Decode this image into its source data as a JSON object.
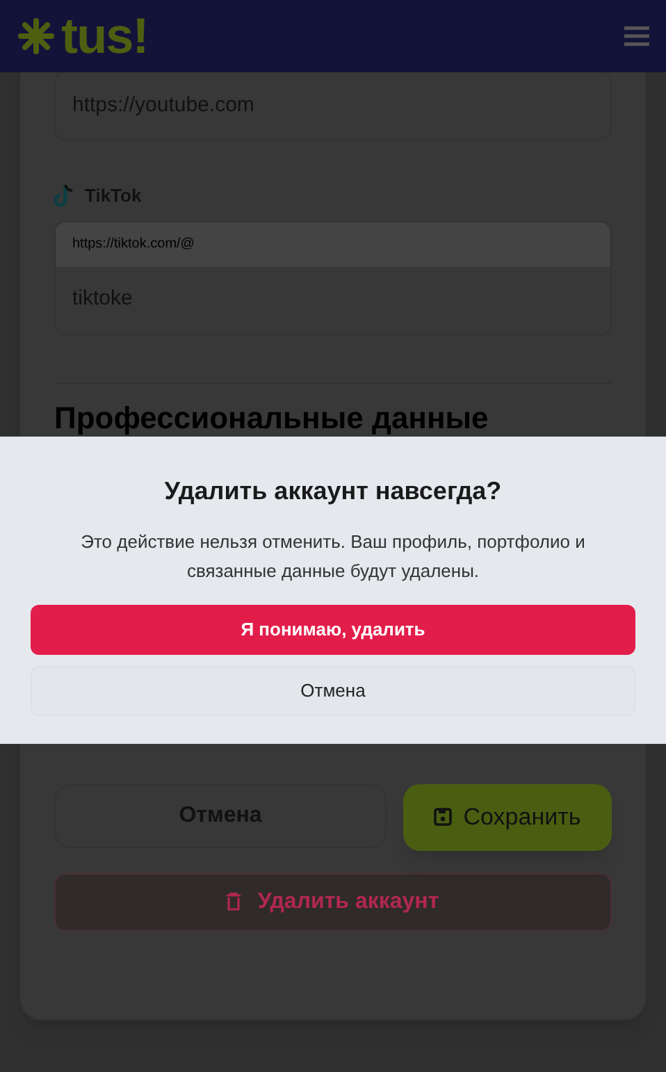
{
  "header": {
    "logo": "tus!"
  },
  "fields": [
    {
      "kind": "plain",
      "value": "https://youtube.com"
    },
    {
      "kind": "prefixed",
      "label": "TikTok",
      "prefix": "https://tiktok.com/@",
      "value": "tiktoke"
    }
  ],
  "section_heading": "Профессиональные данные",
  "actions": {
    "cancel": "Отмена",
    "save": "Сохранить",
    "delete": "Удалить аккаунт"
  },
  "dialog": {
    "title": "Удалить аккаунт навсегда?",
    "message": "Это действие нельзя отменить. Ваш профиль, портфолио и связанные данные будут удалены.",
    "confirm": "Я понимаю, удалить",
    "cancel": "Отмена"
  }
}
